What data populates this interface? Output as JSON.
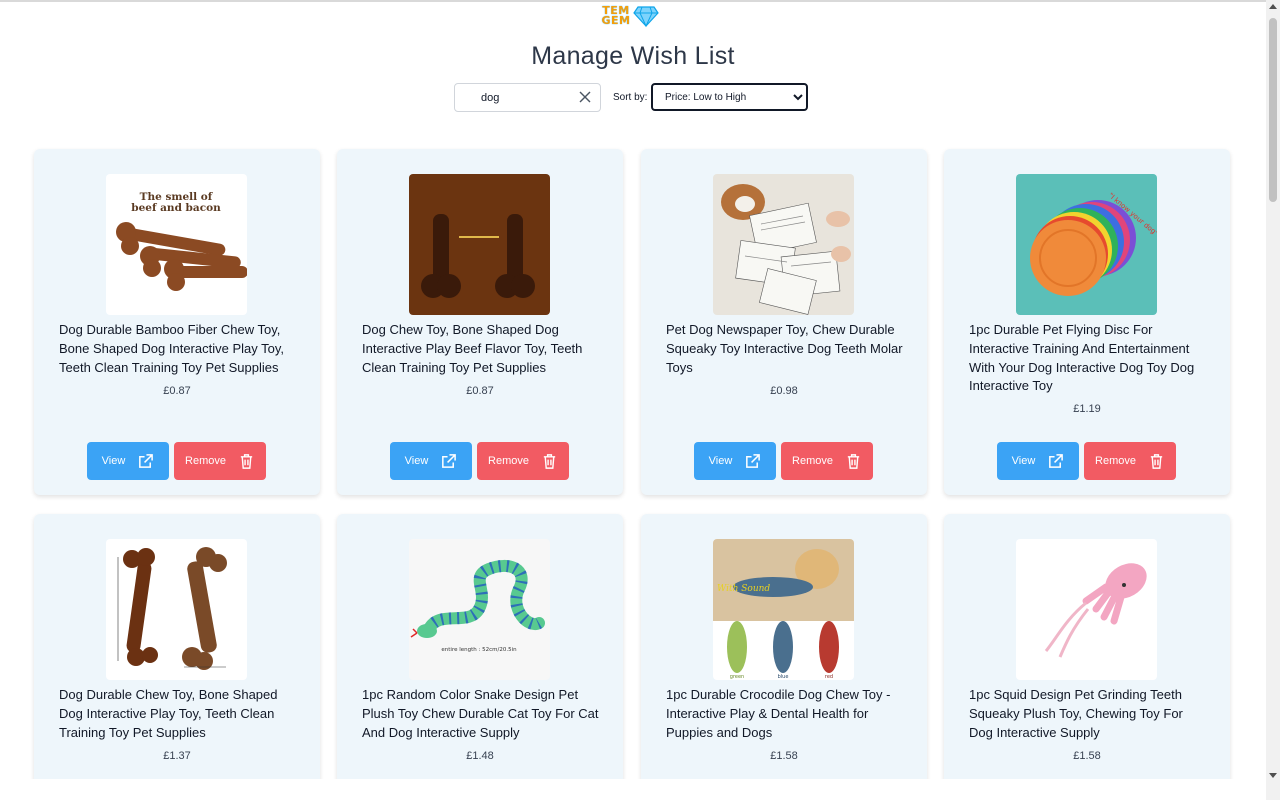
{
  "brand": {
    "logo_line1": "TEM",
    "logo_line2": "GEM",
    "accent": "#f59e0b",
    "gem_color": "#38bdf8"
  },
  "page": {
    "title": "Manage Wish List"
  },
  "search": {
    "value": "dog",
    "placeholder": "",
    "clear_icon": "close-icon"
  },
  "sort": {
    "label": "Sort by:",
    "selected": "Price: Low to High"
  },
  "buttons": {
    "view_label": "View",
    "remove_label": "Remove",
    "view_color": "#3ba3f5",
    "remove_color": "#f25b63"
  },
  "products": [
    {
      "name": "Dog Durable Bamboo Fiber Chew Toy, Bone Shaped Dog Interactive Play Toy, Teeth Clean Training Toy Pet Supplies",
      "price": "£0.87",
      "image_text_1": "The smell of",
      "image_text_2": "beef and bacon"
    },
    {
      "name": "Dog Chew Toy, Bone Shaped Dog Interactive Play Beef Flavor Toy, Teeth Clean Training Toy Pet Supplies",
      "price": "£0.87"
    },
    {
      "name": "Pet Dog Newspaper Toy, Chew Durable Squeaky Toy Interactive Dog Teeth Molar Toys",
      "price": "£0.98"
    },
    {
      "name": "1pc Durable Pet Flying Disc For Interactive Training And Entertainment With Your Dog Interactive Dog Toy Dog Interactive Toy",
      "price": "£1.19",
      "image_text_1": "\"I know your dog\""
    },
    {
      "name": "Dog Durable Chew Toy, Bone Shaped Dog Interactive Play Toy, Teeth Clean Training Toy Pet Supplies",
      "price": "£1.37"
    },
    {
      "name": "1pc Random Color Snake Design Pet Plush Toy Chew Durable Cat Toy For Cat And Dog Interactive Supply",
      "price": "£1.48",
      "image_text_1": "entire length : 52cm/20.5in"
    },
    {
      "name": "1pc Durable Crocodile Dog Chew Toy - Interactive Play & Dental Health for Puppies and Dogs",
      "price": "£1.58",
      "image_text_1": "With Sound",
      "image_text_2": "green",
      "image_text_3": "blue",
      "image_text_4": "red"
    },
    {
      "name": "1pc Squid Design Pet Grinding Teeth Squeaky Plush Toy, Chewing Toy For Dog Interactive Supply",
      "price": "£1.58"
    }
  ]
}
